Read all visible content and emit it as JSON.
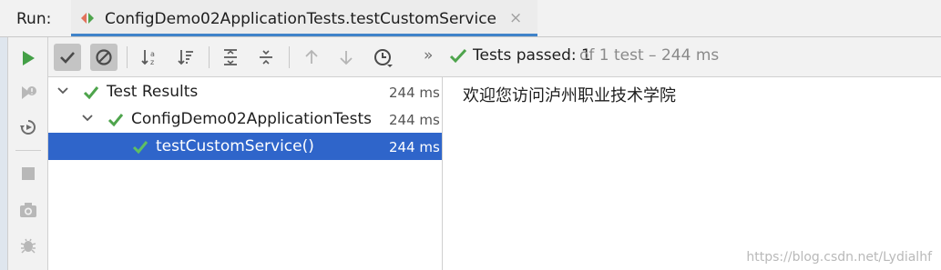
{
  "run_header": {
    "label": "Run:",
    "tab_title": "ConfigDemo02ApplicationTests.testCustomService",
    "close_glyph": "×"
  },
  "toolbar": {
    "status_passed": "Tests passed: 1",
    "status_count": "of 1 test – 244 ms",
    "more_glyph": "»"
  },
  "tree": {
    "items": [
      {
        "label": "Test Results",
        "duration": "244 ms"
      },
      {
        "label": "ConfigDemo02ApplicationTests",
        "duration": "244 ms"
      },
      {
        "label": "testCustomService()",
        "duration": "244 ms"
      }
    ]
  },
  "output": {
    "text": "欢迎您访问泸州职业技术学院"
  },
  "watermark": "https://blog.csdn.net/Lydialhf",
  "colors": {
    "pass_green": "#4ea44c",
    "run_green": "#44a047",
    "selection": "#2f65ca",
    "tab_underline": "#4083c9"
  }
}
